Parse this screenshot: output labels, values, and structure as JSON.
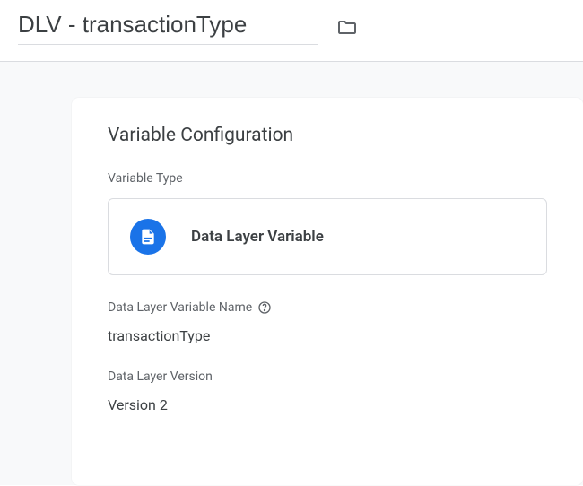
{
  "header": {
    "title": "DLV - transactionType"
  },
  "card": {
    "heading": "Variable Configuration",
    "variableType": {
      "label": "Variable Type",
      "selected": "Data Layer Variable"
    },
    "variableName": {
      "label": "Data Layer Variable Name",
      "value": "transactionType"
    },
    "dataLayerVersion": {
      "label": "Data Layer Version",
      "value": "Version 2"
    }
  }
}
